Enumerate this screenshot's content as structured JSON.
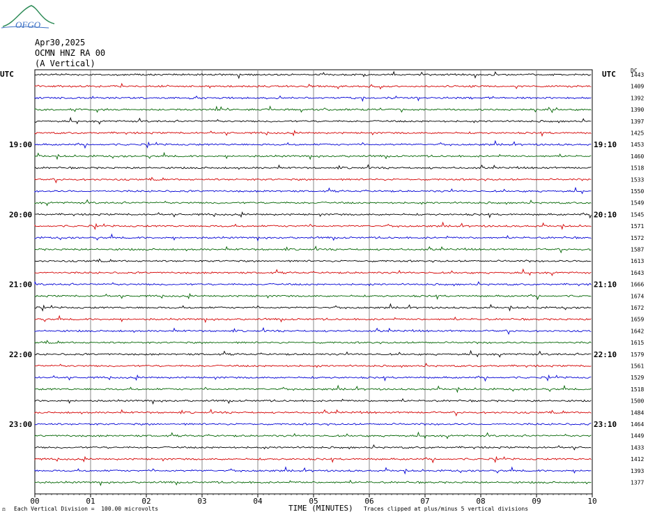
{
  "header": {
    "date": "Apr30,2025",
    "station": "OCMN HNZ RA 00",
    "component": "(A Vertical)",
    "logo_text": "OFGO"
  },
  "chart_data": {
    "type": "line",
    "title": "OCMN HNZ RA 00",
    "xlabel": "TIME (MINUTES)",
    "x_ticks": [
      "00",
      "01",
      "02",
      "03",
      "04",
      "05",
      "06",
      "07",
      "08",
      "09",
      "10"
    ],
    "xlim": [
      0,
      10
    ],
    "left_axis_title": "UTC",
    "right_axis_title": "UTC",
    "dc_title": "DC",
    "left_time_labels": [
      {
        "row": 6,
        "text": "19:00"
      },
      {
        "row": 12,
        "text": "20:00"
      },
      {
        "row": 18,
        "text": "21:00"
      },
      {
        "row": 24,
        "text": "22:00"
      },
      {
        "row": 30,
        "text": "23:00"
      }
    ],
    "right_time_labels": [
      {
        "row": 6,
        "text": "19:10"
      },
      {
        "row": 12,
        "text": "20:10"
      },
      {
        "row": 18,
        "text": "21:10"
      },
      {
        "row": 24,
        "text": "22:10"
      },
      {
        "row": 30,
        "text": "23:10"
      }
    ],
    "trace_colors": [
      "#000000",
      "#d40000",
      "#0000d4",
      "#006400"
    ],
    "trace_color_order_start": 0,
    "dc_offsets": [
      1443,
      1409,
      1392,
      1390,
      1397,
      1425,
      1453,
      1460,
      1518,
      1533,
      1550,
      1549,
      1545,
      1571,
      1572,
      1587,
      1613,
      1643,
      1666,
      1674,
      1672,
      1659,
      1642,
      1615,
      1579,
      1561,
      1529,
      1518,
      1500,
      1484,
      1464,
      1449,
      1433,
      1412,
      1393,
      1377
    ],
    "grid": true,
    "footer_left": "Each Vertical Division =  100.00 microvolts",
    "footer_right": "Traces clipped at plus/minus 5 vertical divisions"
  }
}
